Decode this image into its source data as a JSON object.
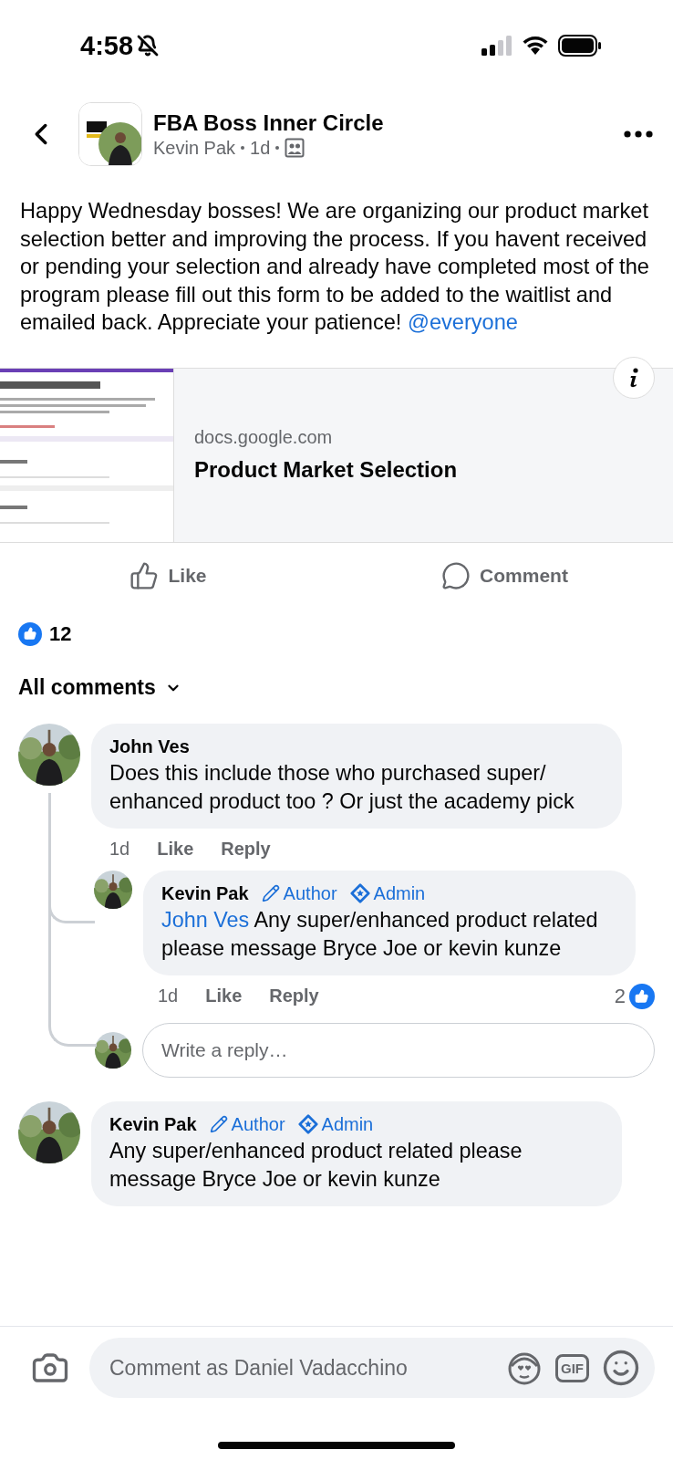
{
  "status_bar": {
    "time": "4:58",
    "silenced": true
  },
  "header": {
    "group_name": "FBA Boss Inner Circle",
    "author": "Kevin Pak",
    "time": "1d"
  },
  "post": {
    "text": "Happy Wednesday bosses! We are organizing our product market selection better and improving the process. If you havent received or pending your selection and already have completed most of the program please fill out this form to be added to the waitlist and emailed back. Appreciate your patience!",
    "mention": "@everyone"
  },
  "link_preview": {
    "domain": "docs.google.com",
    "title": "Product Market Selection"
  },
  "actions": [
    {
      "kind": "like",
      "label": "Like"
    },
    {
      "kind": "comment",
      "label": "Comment"
    }
  ],
  "reactions": {
    "count": "12"
  },
  "comments_filter": "All comments",
  "comments": [
    {
      "author": "John Ves",
      "text": "Does this include those who purchased super/ enhanced product too ? Or just the academy pick",
      "time": "1d",
      "actions": [
        "Like",
        "Reply"
      ],
      "replies": [
        {
          "author": "Kevin Pak",
          "badges": [
            {
              "kind": "author",
              "label": "Author"
            },
            {
              "kind": "admin",
              "label": "Admin"
            }
          ],
          "mention": "John Ves",
          "text": "Any super/enhanced product related please message Bryce Joe or kevin kunze",
          "time": "1d",
          "actions": [
            "Like",
            "Reply"
          ],
          "like_count": "2"
        }
      ],
      "reply_field": {
        "placeholder": "Write a reply…"
      }
    },
    {
      "author": "Kevin Pak",
      "badges": [
        {
          "kind": "author",
          "label": "Author"
        },
        {
          "kind": "admin",
          "label": "Admin"
        }
      ],
      "text": "Any super/enhanced product related please message Bryce Joe or kevin kunze"
    }
  ],
  "composer": {
    "placeholder": "Comment as Daniel Vadacchino",
    "gif_label": "GIF"
  }
}
